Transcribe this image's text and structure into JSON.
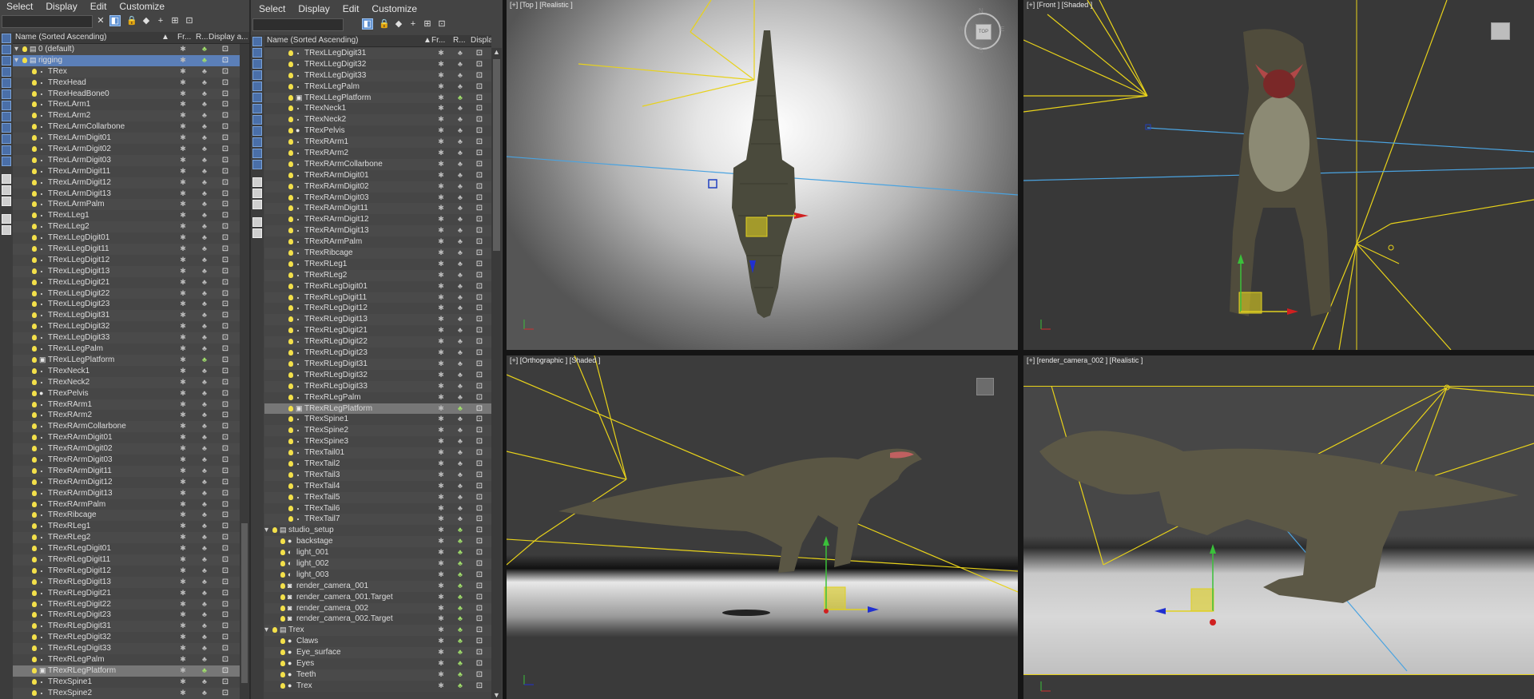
{
  "left_explorer": {
    "menu": [
      "Select",
      "Display",
      "Edit",
      "Customize"
    ],
    "columns": [
      "Name (Sorted Ascending)",
      "Fr...",
      "R...",
      "Display a..."
    ],
    "rows": [
      {
        "name": "0 (default)",
        "indent": 0,
        "kind": "layer",
        "render_green": true
      },
      {
        "name": "rigging",
        "indent": 0,
        "kind": "layer",
        "selected": true,
        "render_green": true
      },
      {
        "name": "TRex",
        "indent": 1,
        "kind": "bone"
      },
      {
        "name": "TRexHead",
        "indent": 1,
        "kind": "bone"
      },
      {
        "name": "TRexHeadBone0",
        "indent": 1,
        "kind": "bone"
      },
      {
        "name": "TRexLArm1",
        "indent": 1,
        "kind": "bone"
      },
      {
        "name": "TRexLArm2",
        "indent": 1,
        "kind": "bone"
      },
      {
        "name": "TRexLArmCollarbone",
        "indent": 1,
        "kind": "bone"
      },
      {
        "name": "TRexLArmDigit01",
        "indent": 1,
        "kind": "bone"
      },
      {
        "name": "TRexLArmDigit02",
        "indent": 1,
        "kind": "bone"
      },
      {
        "name": "TRexLArmDigit03",
        "indent": 1,
        "kind": "bone"
      },
      {
        "name": "TRexLArmDigit11",
        "indent": 1,
        "kind": "bone"
      },
      {
        "name": "TRexLArmDigit12",
        "indent": 1,
        "kind": "bone"
      },
      {
        "name": "TRexLArmDigit13",
        "indent": 1,
        "kind": "bone"
      },
      {
        "name": "TRexLArmPalm",
        "indent": 1,
        "kind": "bone"
      },
      {
        "name": "TRexLLeg1",
        "indent": 1,
        "kind": "bone"
      },
      {
        "name": "TRexLLeg2",
        "indent": 1,
        "kind": "bone"
      },
      {
        "name": "TRexLLegDigit01",
        "indent": 1,
        "kind": "bone"
      },
      {
        "name": "TRexLLegDigit11",
        "indent": 1,
        "kind": "bone"
      },
      {
        "name": "TRexLLegDigit12",
        "indent": 1,
        "kind": "bone"
      },
      {
        "name": "TRexLLegDigit13",
        "indent": 1,
        "kind": "bone"
      },
      {
        "name": "TRexLLegDigit21",
        "indent": 1,
        "kind": "bone"
      },
      {
        "name": "TRexLLegDigit22",
        "indent": 1,
        "kind": "bone"
      },
      {
        "name": "TRexLLegDigit23",
        "indent": 1,
        "kind": "bone"
      },
      {
        "name": "TRexLLegDigit31",
        "indent": 1,
        "kind": "bone"
      },
      {
        "name": "TRexLLegDigit32",
        "indent": 1,
        "kind": "bone"
      },
      {
        "name": "TRexLLegDigit33",
        "indent": 1,
        "kind": "bone"
      },
      {
        "name": "TRexLLegPalm",
        "indent": 1,
        "kind": "bone"
      },
      {
        "name": "TRexLLegPlatform",
        "indent": 1,
        "kind": "helper",
        "render_green": true
      },
      {
        "name": "TRexNeck1",
        "indent": 1,
        "kind": "bone"
      },
      {
        "name": "TRexNeck2",
        "indent": 1,
        "kind": "bone"
      },
      {
        "name": "TRexPelvis",
        "indent": 1,
        "kind": "sphere"
      },
      {
        "name": "TRexRArm1",
        "indent": 1,
        "kind": "bone"
      },
      {
        "name": "TRexRArm2",
        "indent": 1,
        "kind": "bone"
      },
      {
        "name": "TRexRArmCollarbone",
        "indent": 1,
        "kind": "bone"
      },
      {
        "name": "TRexRArmDigit01",
        "indent": 1,
        "kind": "bone"
      },
      {
        "name": "TRexRArmDigit02",
        "indent": 1,
        "kind": "bone"
      },
      {
        "name": "TRexRArmDigit03",
        "indent": 1,
        "kind": "bone"
      },
      {
        "name": "TRexRArmDigit11",
        "indent": 1,
        "kind": "bone"
      },
      {
        "name": "TRexRArmDigit12",
        "indent": 1,
        "kind": "bone"
      },
      {
        "name": "TRexRArmDigit13",
        "indent": 1,
        "kind": "bone"
      },
      {
        "name": "TRexRArmPalm",
        "indent": 1,
        "kind": "bone"
      },
      {
        "name": "TRexRibcage",
        "indent": 1,
        "kind": "bone"
      },
      {
        "name": "TRexRLeg1",
        "indent": 1,
        "kind": "bone"
      },
      {
        "name": "TRexRLeg2",
        "indent": 1,
        "kind": "bone"
      },
      {
        "name": "TRexRLegDigit01",
        "indent": 1,
        "kind": "bone"
      },
      {
        "name": "TRexRLegDigit11",
        "indent": 1,
        "kind": "bone"
      },
      {
        "name": "TRexRLegDigit12",
        "indent": 1,
        "kind": "bone"
      },
      {
        "name": "TRexRLegDigit13",
        "indent": 1,
        "kind": "bone"
      },
      {
        "name": "TRexRLegDigit21",
        "indent": 1,
        "kind": "bone"
      },
      {
        "name": "TRexRLegDigit22",
        "indent": 1,
        "kind": "bone"
      },
      {
        "name": "TRexRLegDigit23",
        "indent": 1,
        "kind": "bone"
      },
      {
        "name": "TRexRLegDigit31",
        "indent": 1,
        "kind": "bone"
      },
      {
        "name": "TRexRLegDigit32",
        "indent": 1,
        "kind": "bone"
      },
      {
        "name": "TRexRLegDigit33",
        "indent": 1,
        "kind": "bone"
      },
      {
        "name": "TRexRLegPalm",
        "indent": 1,
        "kind": "bone"
      },
      {
        "name": "TRexRLegPlatform",
        "indent": 1,
        "kind": "helper",
        "highlight": true,
        "render_green": true
      },
      {
        "name": "TRexSpine1",
        "indent": 1,
        "kind": "bone"
      },
      {
        "name": "TRexSpine2",
        "indent": 1,
        "kind": "bone"
      }
    ]
  },
  "right_explorer": {
    "menu": [
      "Select",
      "Display",
      "Edit",
      "Customize"
    ],
    "columns": [
      "Name (Sorted Ascending)",
      "Fr...",
      "R...",
      "Display a..."
    ],
    "rows": [
      {
        "name": "TRexLLegDigit31",
        "indent": 2,
        "kind": "bone"
      },
      {
        "name": "TRexLLegDigit32",
        "indent": 2,
        "kind": "bone"
      },
      {
        "name": "TRexLLegDigit33",
        "indent": 2,
        "kind": "bone"
      },
      {
        "name": "TRexLLegPalm",
        "indent": 2,
        "kind": "bone"
      },
      {
        "name": "TRexLLegPlatform",
        "indent": 2,
        "kind": "helper",
        "render_green": true
      },
      {
        "name": "TRexNeck1",
        "indent": 2,
        "kind": "bone"
      },
      {
        "name": "TRexNeck2",
        "indent": 2,
        "kind": "bone"
      },
      {
        "name": "TRexPelvis",
        "indent": 2,
        "kind": "sphere"
      },
      {
        "name": "TRexRArm1",
        "indent": 2,
        "kind": "bone"
      },
      {
        "name": "TRexRArm2",
        "indent": 2,
        "kind": "bone"
      },
      {
        "name": "TRexRArmCollarbone",
        "indent": 2,
        "kind": "bone"
      },
      {
        "name": "TRexRArmDigit01",
        "indent": 2,
        "kind": "bone"
      },
      {
        "name": "TRexRArmDigit02",
        "indent": 2,
        "kind": "bone"
      },
      {
        "name": "TRexRArmDigit03",
        "indent": 2,
        "kind": "bone"
      },
      {
        "name": "TRexRArmDigit11",
        "indent": 2,
        "kind": "bone"
      },
      {
        "name": "TRexRArmDigit12",
        "indent": 2,
        "kind": "bone"
      },
      {
        "name": "TRexRArmDigit13",
        "indent": 2,
        "kind": "bone"
      },
      {
        "name": "TRexRArmPalm",
        "indent": 2,
        "kind": "bone"
      },
      {
        "name": "TRexRibcage",
        "indent": 2,
        "kind": "bone"
      },
      {
        "name": "TRexRLeg1",
        "indent": 2,
        "kind": "bone"
      },
      {
        "name": "TRexRLeg2",
        "indent": 2,
        "kind": "bone"
      },
      {
        "name": "TRexRLegDigit01",
        "indent": 2,
        "kind": "bone"
      },
      {
        "name": "TRexRLegDigit11",
        "indent": 2,
        "kind": "bone"
      },
      {
        "name": "TRexRLegDigit12",
        "indent": 2,
        "kind": "bone"
      },
      {
        "name": "TRexRLegDigit13",
        "indent": 2,
        "kind": "bone"
      },
      {
        "name": "TRexRLegDigit21",
        "indent": 2,
        "kind": "bone"
      },
      {
        "name": "TRexRLegDigit22",
        "indent": 2,
        "kind": "bone"
      },
      {
        "name": "TRexRLegDigit23",
        "indent": 2,
        "kind": "bone"
      },
      {
        "name": "TRexRLegDigit31",
        "indent": 2,
        "kind": "bone"
      },
      {
        "name": "TRexRLegDigit32",
        "indent": 2,
        "kind": "bone"
      },
      {
        "name": "TRexRLegDigit33",
        "indent": 2,
        "kind": "bone"
      },
      {
        "name": "TRexRLegPalm",
        "indent": 2,
        "kind": "bone"
      },
      {
        "name": "TRexRLegPlatform",
        "indent": 2,
        "kind": "helper",
        "highlight": true,
        "render_green": true
      },
      {
        "name": "TRexSpine1",
        "indent": 2,
        "kind": "bone"
      },
      {
        "name": "TRexSpine2",
        "indent": 2,
        "kind": "bone"
      },
      {
        "name": "TRexSpine3",
        "indent": 2,
        "kind": "bone"
      },
      {
        "name": "TRexTail01",
        "indent": 2,
        "kind": "bone"
      },
      {
        "name": "TRexTail2",
        "indent": 2,
        "kind": "bone"
      },
      {
        "name": "TRexTail3",
        "indent": 2,
        "kind": "bone"
      },
      {
        "name": "TRexTail4",
        "indent": 2,
        "kind": "bone"
      },
      {
        "name": "TRexTail5",
        "indent": 2,
        "kind": "bone"
      },
      {
        "name": "TRexTail6",
        "indent": 2,
        "kind": "bone"
      },
      {
        "name": "TRexTail7",
        "indent": 2,
        "kind": "bone"
      },
      {
        "name": "studio_setup",
        "indent": 0,
        "kind": "layer",
        "expanded": true,
        "render_green": true
      },
      {
        "name": "backstage",
        "indent": 1,
        "kind": "sphere",
        "render_green": true
      },
      {
        "name": "light_001",
        "indent": 1,
        "kind": "light",
        "render_green": true
      },
      {
        "name": "light_002",
        "indent": 1,
        "kind": "light",
        "render_green": true
      },
      {
        "name": "light_003",
        "indent": 1,
        "kind": "light",
        "render_green": true
      },
      {
        "name": "render_camera_001",
        "indent": 1,
        "kind": "camera",
        "render_green": true
      },
      {
        "name": "render_camera_001.Target",
        "indent": 1,
        "kind": "camera",
        "render_green": true
      },
      {
        "name": "render_camera_002",
        "indent": 1,
        "kind": "camera",
        "render_green": true
      },
      {
        "name": "render_camera_002.Target",
        "indent": 1,
        "kind": "camera",
        "render_green": true
      },
      {
        "name": "Trex",
        "indent": 0,
        "kind": "layer",
        "expanded": true,
        "render_green": true
      },
      {
        "name": "Claws",
        "indent": 1,
        "kind": "sphere",
        "render_green": true
      },
      {
        "name": "Eye_surface",
        "indent": 1,
        "kind": "sphere",
        "render_green": true
      },
      {
        "name": "Eyes",
        "indent": 1,
        "kind": "sphere",
        "render_green": true
      },
      {
        "name": "Teeth",
        "indent": 1,
        "kind": "sphere",
        "render_green": true
      },
      {
        "name": "Trex",
        "indent": 1,
        "kind": "sphere",
        "render_green": true
      }
    ]
  },
  "viewports": {
    "top": {
      "label": "[+] [Top ] [Realistic ]"
    },
    "front": {
      "label": "[+] [Front ] [Shaded ]"
    },
    "ortho": {
      "label": "[+] [Orthographic ] [Shaded ]"
    },
    "camera": {
      "label": "[+] [render_camera_002 ] [Realistic ]"
    }
  },
  "colors": {
    "panel_bg": "#444444",
    "selected_row": "#5b7fb8",
    "highlight_row": "#777777",
    "bulb": "#f3e04a",
    "render_green": "#9fdc6a",
    "camera_lines": "#e8d21a",
    "light_lines": "#4aa3e0"
  }
}
